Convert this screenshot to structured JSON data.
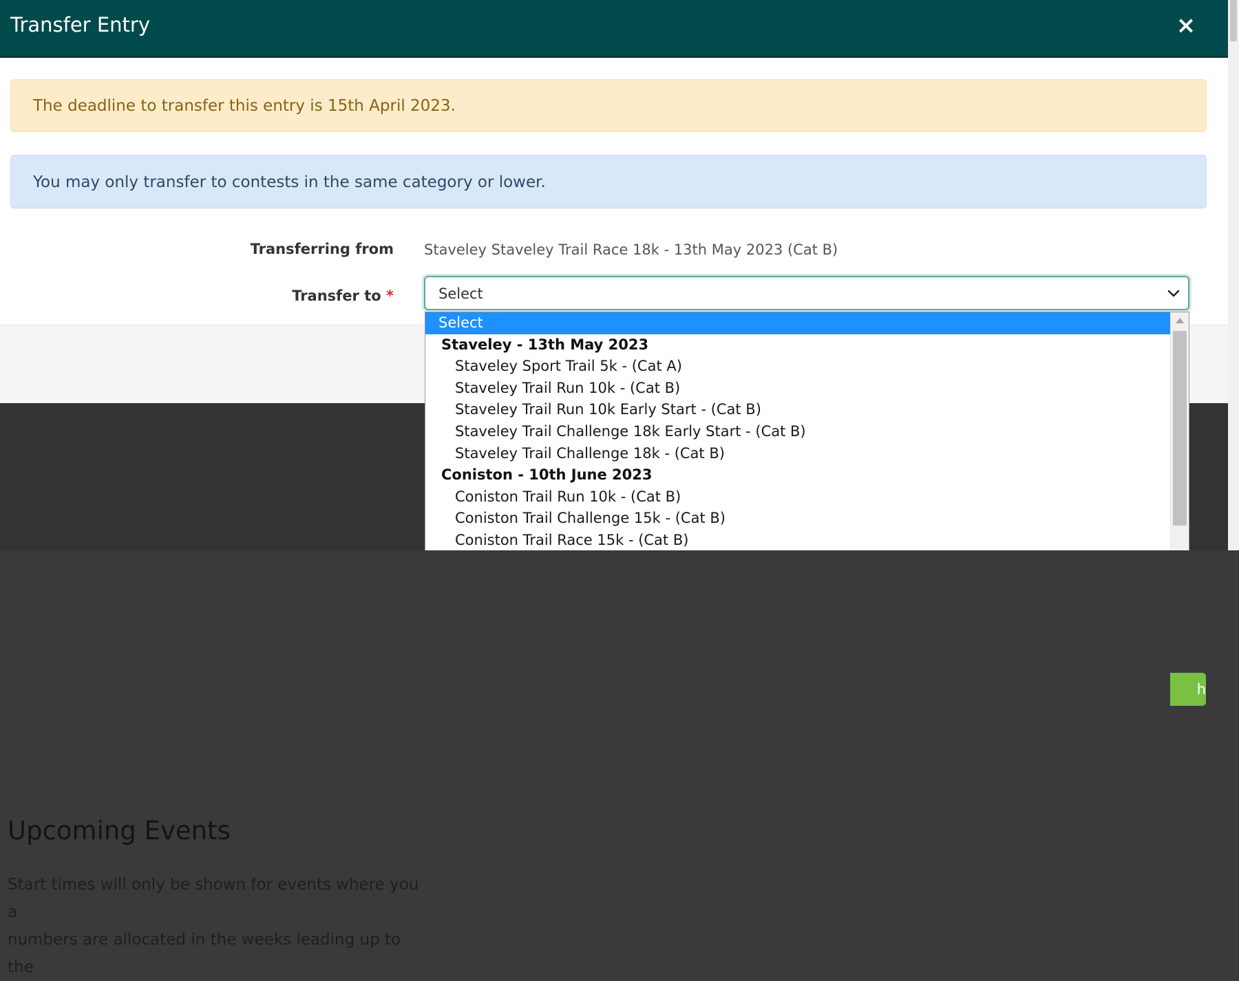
{
  "modal": {
    "title": "Transfer Entry",
    "close_label": "×"
  },
  "alerts": {
    "deadline": "The deadline to transfer this entry is 15th April 2023.",
    "category_rule": "You may only transfer to contests in the same category or lower."
  },
  "form": {
    "from_label": "Transferring from",
    "from_value": "Staveley Staveley Trail Race 18k - 13th May 2023",
    "from_category": "(Cat B)",
    "to_label": "Transfer to",
    "required_mark": "*",
    "to_selected": "Select"
  },
  "dropdown": {
    "selected": "Select",
    "groups": [
      {
        "label": "Staveley - 13th May 2023",
        "options": [
          "Staveley Sport Trail 5k - (Cat A)",
          "Staveley Trail Run 10k - (Cat B)",
          "Staveley Trail Run 10k Early Start - (Cat B)",
          "Staveley Trail Challenge 18k Early Start - (Cat B)",
          "Staveley Trail Challenge 18k - (Cat B)"
        ]
      },
      {
        "label": "Coniston - 10th June 2023",
        "options": [
          "Coniston Trail Run 10k - (Cat B)",
          "Coniston Trail Challenge 15k - (Cat B)",
          "Coniston Trail Race 15k - (Cat B)"
        ]
      }
    ]
  },
  "footer": {
    "button_label_partial": "h"
  },
  "background": {
    "title": "Upcoming Events",
    "text_line1": "Start times will only be shown for events where you a",
    "text_line2": "numbers are allocated in the weeks leading up to the"
  },
  "colors": {
    "header": "#004a4b",
    "warning_bg": "#fcecca",
    "info_bg": "#d8e8f8",
    "selected_option": "#1e90ff",
    "button_green": "#7ac043"
  }
}
